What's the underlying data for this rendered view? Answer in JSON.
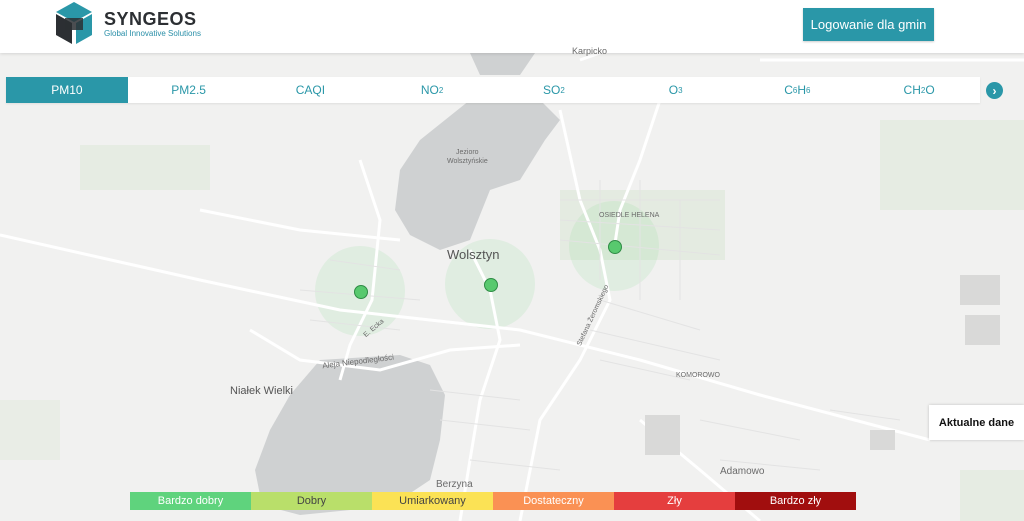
{
  "header": {
    "logo_title": "SYNGEOS",
    "logo_subtitle": "Global Innovative Solutions",
    "login_label": "Logowanie dla gmin"
  },
  "tabs": [
    {
      "label": "PM10",
      "active": true
    },
    {
      "label": "PM2.5"
    },
    {
      "label": "CAQI"
    },
    {
      "label": "NO",
      "sub": "2"
    },
    {
      "label": "SO",
      "sub": "2"
    },
    {
      "label": "O",
      "sub": "3"
    },
    {
      "label": "C",
      "sub": "6",
      "label2": "H",
      "sub2": "6"
    },
    {
      "label": "CH",
      "sub": "2",
      "label2": "O"
    }
  ],
  "next_icon": "chevron-right-icon",
  "current_data_label": "Aktualne dane",
  "legend": [
    {
      "label": "Bardzo dobry",
      "color": "#5fd37d",
      "text_color": "#ffffff"
    },
    {
      "label": "Dobry",
      "color": "#b9df6a",
      "text_color": "#444444"
    },
    {
      "label": "Umiarkowany",
      "color": "#fbe255",
      "text_color": "#444444"
    },
    {
      "label": "Dostateczny",
      "color": "#fa9154",
      "text_color": "#ffffff"
    },
    {
      "label": "Zły",
      "color": "#e53e3e",
      "text_color": "#ffffff"
    },
    {
      "label": "Bardzo zły",
      "color": "#a10e0e",
      "text_color": "#ffffff"
    }
  ],
  "map": {
    "labels": {
      "wolsztyn": "Wolsztyn",
      "jezioro": "Jezioro",
      "jezioro2": "Wolsztyńskie",
      "osiedle": "OSIEDLE HELENA",
      "nialek": "Niałek Wielki",
      "komorowo": "KOMOROWO",
      "berzyna": "Berzyna",
      "adamowo": "Adamowo",
      "karpicko": "Karpicko",
      "aleja": "Aleja Niepodległości",
      "zeromskiego": "Stefana Żeromskiego",
      "ecka": "E. Ecka"
    }
  }
}
